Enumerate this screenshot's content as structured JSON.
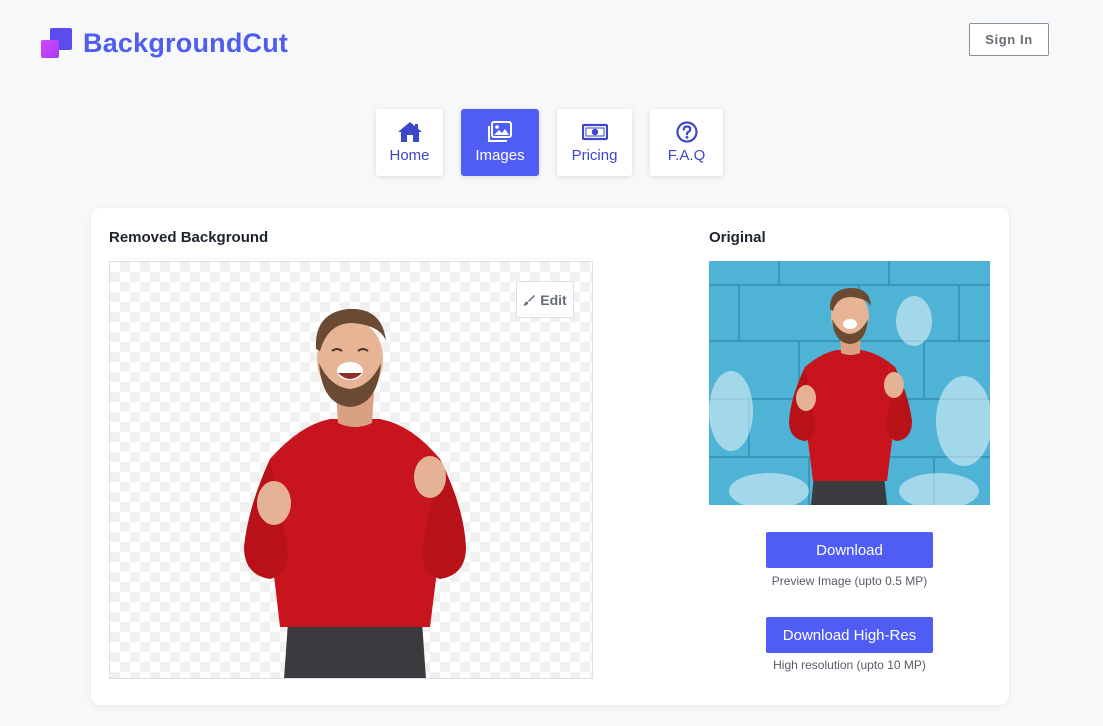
{
  "brand": {
    "name": "BackgroundCut"
  },
  "header": {
    "signin_label": "Sign In"
  },
  "nav": {
    "tabs": [
      {
        "label": "Home",
        "icon": "home-icon",
        "active": false
      },
      {
        "label": "Images",
        "icon": "images-icon",
        "active": true
      },
      {
        "label": "Pricing",
        "icon": "money-icon",
        "active": false
      },
      {
        "label": "F.A.Q",
        "icon": "question-circle-icon",
        "active": false
      }
    ]
  },
  "result": {
    "title": "Removed Background",
    "edit_label": "Edit"
  },
  "original": {
    "title": "Original"
  },
  "downloads": {
    "preview_label": "Download",
    "preview_note": "Preview Image (upto 0.5 MP)",
    "highres_label": "Download High-Res",
    "highres_note": "High resolution (upto 10 MP)"
  },
  "colors": {
    "accent": "#4f5df5",
    "brand_text": "#4f5df0",
    "logo_purple": "#5b4cf0",
    "logo_magenta": "#d646ff",
    "sweater_red": "#c8141c",
    "wall_blue": "#4fb3d6"
  }
}
